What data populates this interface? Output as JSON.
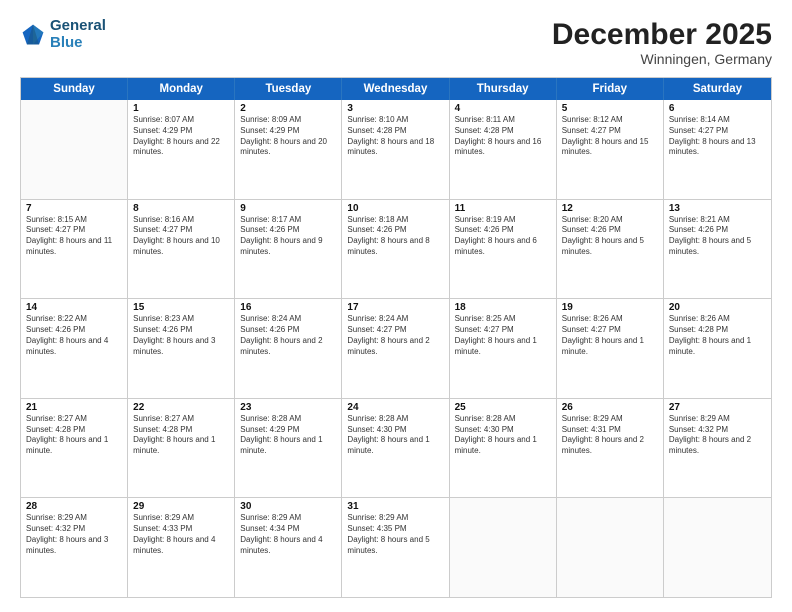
{
  "header": {
    "logo_line1": "General",
    "logo_line2": "Blue",
    "title": "December 2025",
    "subtitle": "Winningen, Germany"
  },
  "calendar": {
    "days_of_week": [
      "Sunday",
      "Monday",
      "Tuesday",
      "Wednesday",
      "Thursday",
      "Friday",
      "Saturday"
    ],
    "weeks": [
      [
        {
          "day": "",
          "sunrise": "",
          "sunset": "",
          "daylight": ""
        },
        {
          "day": "1",
          "sunrise": "Sunrise: 8:07 AM",
          "sunset": "Sunset: 4:29 PM",
          "daylight": "Daylight: 8 hours and 22 minutes."
        },
        {
          "day": "2",
          "sunrise": "Sunrise: 8:09 AM",
          "sunset": "Sunset: 4:29 PM",
          "daylight": "Daylight: 8 hours and 20 minutes."
        },
        {
          "day": "3",
          "sunrise": "Sunrise: 8:10 AM",
          "sunset": "Sunset: 4:28 PM",
          "daylight": "Daylight: 8 hours and 18 minutes."
        },
        {
          "day": "4",
          "sunrise": "Sunrise: 8:11 AM",
          "sunset": "Sunset: 4:28 PM",
          "daylight": "Daylight: 8 hours and 16 minutes."
        },
        {
          "day": "5",
          "sunrise": "Sunrise: 8:12 AM",
          "sunset": "Sunset: 4:27 PM",
          "daylight": "Daylight: 8 hours and 15 minutes."
        },
        {
          "day": "6",
          "sunrise": "Sunrise: 8:14 AM",
          "sunset": "Sunset: 4:27 PM",
          "daylight": "Daylight: 8 hours and 13 minutes."
        }
      ],
      [
        {
          "day": "7",
          "sunrise": "Sunrise: 8:15 AM",
          "sunset": "Sunset: 4:27 PM",
          "daylight": "Daylight: 8 hours and 11 minutes."
        },
        {
          "day": "8",
          "sunrise": "Sunrise: 8:16 AM",
          "sunset": "Sunset: 4:27 PM",
          "daylight": "Daylight: 8 hours and 10 minutes."
        },
        {
          "day": "9",
          "sunrise": "Sunrise: 8:17 AM",
          "sunset": "Sunset: 4:26 PM",
          "daylight": "Daylight: 8 hours and 9 minutes."
        },
        {
          "day": "10",
          "sunrise": "Sunrise: 8:18 AM",
          "sunset": "Sunset: 4:26 PM",
          "daylight": "Daylight: 8 hours and 8 minutes."
        },
        {
          "day": "11",
          "sunrise": "Sunrise: 8:19 AM",
          "sunset": "Sunset: 4:26 PM",
          "daylight": "Daylight: 8 hours and 6 minutes."
        },
        {
          "day": "12",
          "sunrise": "Sunrise: 8:20 AM",
          "sunset": "Sunset: 4:26 PM",
          "daylight": "Daylight: 8 hours and 5 minutes."
        },
        {
          "day": "13",
          "sunrise": "Sunrise: 8:21 AM",
          "sunset": "Sunset: 4:26 PM",
          "daylight": "Daylight: 8 hours and 5 minutes."
        }
      ],
      [
        {
          "day": "14",
          "sunrise": "Sunrise: 8:22 AM",
          "sunset": "Sunset: 4:26 PM",
          "daylight": "Daylight: 8 hours and 4 minutes."
        },
        {
          "day": "15",
          "sunrise": "Sunrise: 8:23 AM",
          "sunset": "Sunset: 4:26 PM",
          "daylight": "Daylight: 8 hours and 3 minutes."
        },
        {
          "day": "16",
          "sunrise": "Sunrise: 8:24 AM",
          "sunset": "Sunset: 4:26 PM",
          "daylight": "Daylight: 8 hours and 2 minutes."
        },
        {
          "day": "17",
          "sunrise": "Sunrise: 8:24 AM",
          "sunset": "Sunset: 4:27 PM",
          "daylight": "Daylight: 8 hours and 2 minutes."
        },
        {
          "day": "18",
          "sunrise": "Sunrise: 8:25 AM",
          "sunset": "Sunset: 4:27 PM",
          "daylight": "Daylight: 8 hours and 1 minute."
        },
        {
          "day": "19",
          "sunrise": "Sunrise: 8:26 AM",
          "sunset": "Sunset: 4:27 PM",
          "daylight": "Daylight: 8 hours and 1 minute."
        },
        {
          "day": "20",
          "sunrise": "Sunrise: 8:26 AM",
          "sunset": "Sunset: 4:28 PM",
          "daylight": "Daylight: 8 hours and 1 minute."
        }
      ],
      [
        {
          "day": "21",
          "sunrise": "Sunrise: 8:27 AM",
          "sunset": "Sunset: 4:28 PM",
          "daylight": "Daylight: 8 hours and 1 minute."
        },
        {
          "day": "22",
          "sunrise": "Sunrise: 8:27 AM",
          "sunset": "Sunset: 4:28 PM",
          "daylight": "Daylight: 8 hours and 1 minute."
        },
        {
          "day": "23",
          "sunrise": "Sunrise: 8:28 AM",
          "sunset": "Sunset: 4:29 PM",
          "daylight": "Daylight: 8 hours and 1 minute."
        },
        {
          "day": "24",
          "sunrise": "Sunrise: 8:28 AM",
          "sunset": "Sunset: 4:30 PM",
          "daylight": "Daylight: 8 hours and 1 minute."
        },
        {
          "day": "25",
          "sunrise": "Sunrise: 8:28 AM",
          "sunset": "Sunset: 4:30 PM",
          "daylight": "Daylight: 8 hours and 1 minute."
        },
        {
          "day": "26",
          "sunrise": "Sunrise: 8:29 AM",
          "sunset": "Sunset: 4:31 PM",
          "daylight": "Daylight: 8 hours and 2 minutes."
        },
        {
          "day": "27",
          "sunrise": "Sunrise: 8:29 AM",
          "sunset": "Sunset: 4:32 PM",
          "daylight": "Daylight: 8 hours and 2 minutes."
        }
      ],
      [
        {
          "day": "28",
          "sunrise": "Sunrise: 8:29 AM",
          "sunset": "Sunset: 4:32 PM",
          "daylight": "Daylight: 8 hours and 3 minutes."
        },
        {
          "day": "29",
          "sunrise": "Sunrise: 8:29 AM",
          "sunset": "Sunset: 4:33 PM",
          "daylight": "Daylight: 8 hours and 4 minutes."
        },
        {
          "day": "30",
          "sunrise": "Sunrise: 8:29 AM",
          "sunset": "Sunset: 4:34 PM",
          "daylight": "Daylight: 8 hours and 4 minutes."
        },
        {
          "day": "31",
          "sunrise": "Sunrise: 8:29 AM",
          "sunset": "Sunset: 4:35 PM",
          "daylight": "Daylight: 8 hours and 5 minutes."
        },
        {
          "day": "",
          "sunrise": "",
          "sunset": "",
          "daylight": ""
        },
        {
          "day": "",
          "sunrise": "",
          "sunset": "",
          "daylight": ""
        },
        {
          "day": "",
          "sunrise": "",
          "sunset": "",
          "daylight": ""
        }
      ]
    ]
  }
}
